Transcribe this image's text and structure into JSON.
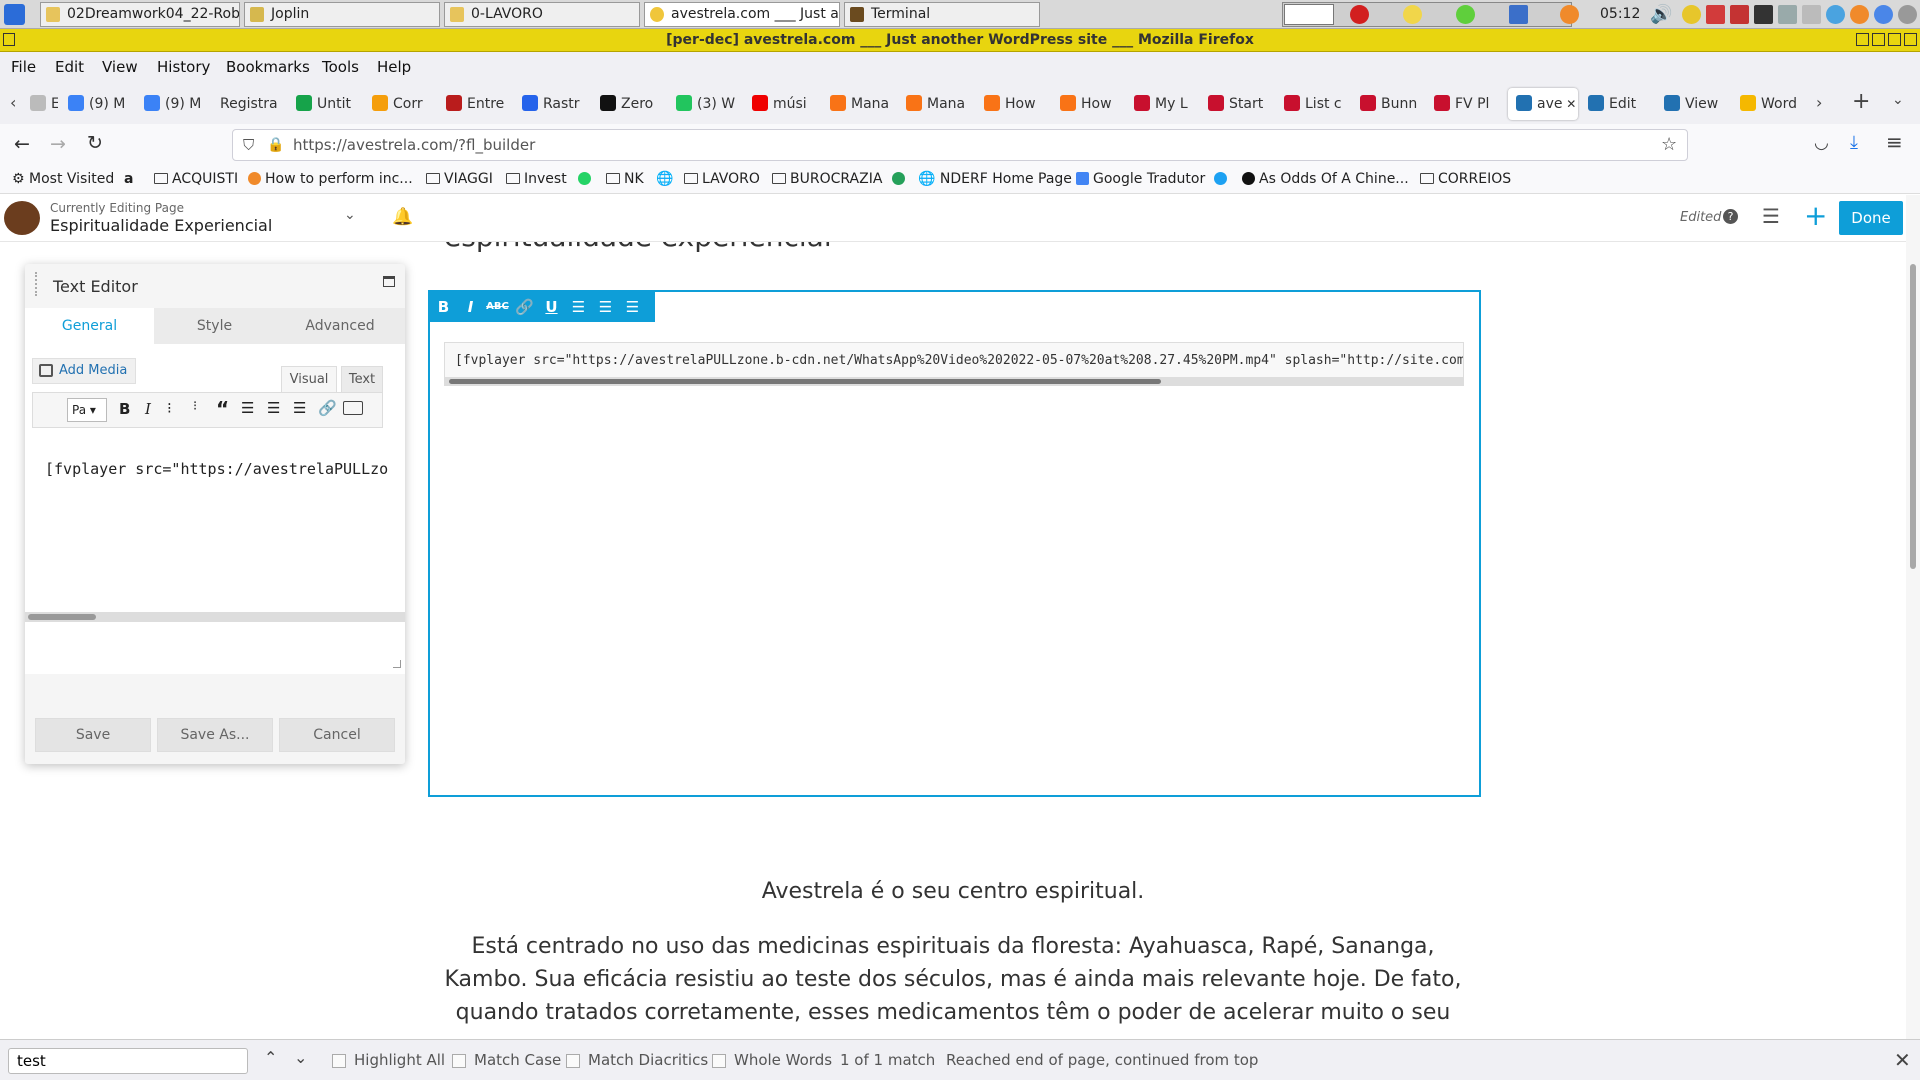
{
  "taskbar": {
    "windows": [
      "02Dreamwork04_22-Rob...",
      "Joplin",
      "0-LAVORO",
      "avestrela.com ___ Just a...",
      "Terminal"
    ],
    "clock": "05:12"
  },
  "window": {
    "title": "[per-dec] avestrela.com ___ Just another WordPress site ___ Mozilla Firefox"
  },
  "menu": [
    "File",
    "Edit",
    "View",
    "History",
    "Bookmarks",
    "Tools",
    "Help"
  ],
  "tabs": [
    {
      "label": "E",
      "color": "#bbbbbb"
    },
    {
      "label": "(9) M",
      "color": "#3b82f6"
    },
    {
      "label": "(9) M",
      "color": "#3b82f6"
    },
    {
      "label": "Registra",
      "color": ""
    },
    {
      "label": "Untit",
      "color": "#16a34a"
    },
    {
      "label": "Corr",
      "color": "#f59e0b"
    },
    {
      "label": "Entre",
      "color": "#b91c1c"
    },
    {
      "label": "Rastr",
      "color": "#2563eb"
    },
    {
      "label": "Zero",
      "color": "#111111"
    },
    {
      "label": "(3) W",
      "color": "#22c55e"
    },
    {
      "label": "músi",
      "color": "#ef0000"
    },
    {
      "label": "Mana",
      "color": "#f97316"
    },
    {
      "label": "Mana",
      "color": "#f97316"
    },
    {
      "label": "How",
      "color": "#f97316"
    },
    {
      "label": "How",
      "color": "#f97316"
    },
    {
      "label": "My L",
      "color": "#c8102e"
    },
    {
      "label": "Start",
      "color": "#c8102e"
    },
    {
      "label": "List c",
      "color": "#c8102e"
    },
    {
      "label": "Bunn",
      "color": "#c8102e"
    },
    {
      "label": "FV Pl",
      "color": "#c8102e"
    },
    {
      "label": "ave",
      "color": "#2271b1"
    },
    {
      "label": "Edit",
      "color": "#2271b1"
    },
    {
      "label": "View",
      "color": "#2271b1"
    },
    {
      "label": "Word",
      "color": "#f5b800"
    }
  ],
  "nav": {
    "url": "https://avestrela.com/?fl_builder"
  },
  "bookmarks": [
    "Most Visited",
    "ACQUISTI",
    "How to perform inc...",
    "VIAGGI",
    "Invest",
    "NK",
    "LAVORO",
    "BUROCRAZIA",
    "NDERF Home Page",
    "Google Tradutor",
    "As Odds Of A Chine...",
    "CORREIOS"
  ],
  "builder": {
    "currently_editing": "Currently Editing Page",
    "page_name": "Espiritualidade Experiencial",
    "edited": "Edited",
    "done": "Done"
  },
  "content": {
    "heading_partial": "espiritualidade experiencial",
    "shortcode": "[fvplayer src=\"https://avestrelaPULLzone.b-cdn.net/WhatsApp%20Video%202022-05-07%20at%208.27.45%20PM.mp4\" splash=\"http://site.com/",
    "para1": "Avestrela é o seu centro espiritual.",
    "para2_lines": [
      "Está centrado no uso das medicinas espirituais da floresta: Ayahuasca, Rapé, Sananga,",
      "Kambo. Sua eficácia resistiu ao teste dos séculos, mas é ainda mais relevante hoje. De fato,",
      "quando tratados corretamente, esses medicamentos têm o poder de acelerar muito o seu"
    ]
  },
  "editor": {
    "title": "Text Editor",
    "tabs": [
      "General",
      "Style",
      "Advanced"
    ],
    "add_media": "Add Media",
    "visual": "Visual",
    "text": "Text",
    "paragraph": "Pa",
    "content": "[fvplayer src=\"https://avestrelaPULLzo",
    "save": "Save",
    "save_as": "Save As...",
    "cancel": "Cancel"
  },
  "find": {
    "query": "test",
    "highlight_all": "Highlight All",
    "match_case": "Match Case",
    "match_diacritics": "Match Diacritics",
    "whole_words": "Whole Words",
    "count": "1 of 1 match",
    "status": "Reached end of page, continued from top"
  },
  "colors": {
    "accent": "#0e9ed8",
    "title_bar": "#e8d50f"
  }
}
